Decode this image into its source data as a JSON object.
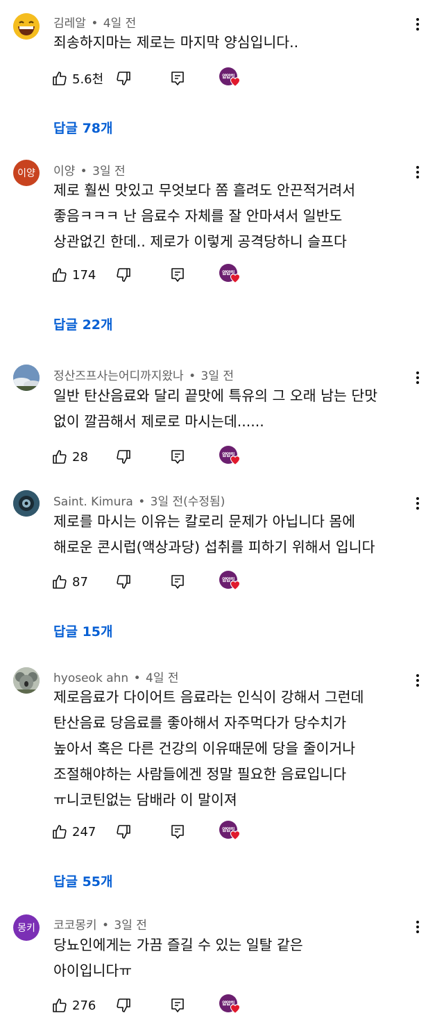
{
  "comments": [
    {
      "author": "김레알",
      "time": "4일 전",
      "edited": "",
      "lines": [
        "죄송하지마는 제로는 마지막 양심입니다.."
      ],
      "likes": "5.6천",
      "replies": "답글 78개",
      "avatar_text": "",
      "avatar_kind": "emoji-grin",
      "avatar_color": "#f2b60d"
    },
    {
      "author": "이양",
      "time": "3일 전",
      "edited": "",
      "lines": [
        "제로 훨씬 맛있고 무엇보다 쫌 흘려도 안끈적거려서",
        "좋음ㅋㅋㅋ 난 음료수 자체를 잘 안마셔서 일반도",
        "상관없긴 한데.. 제로가 이렇게 공격당하니 슬프다"
      ],
      "likes": "174",
      "replies": "답글 22개",
      "avatar_text": "이양",
      "avatar_kind": "initials",
      "avatar_color": "#c8431f"
    },
    {
      "author": "정산즈프사는어디까지왔나",
      "time": "3일 전",
      "edited": "",
      "lines": [
        "일반 탄산음료와 달리 끝맛에 특유의 그 오래 남는 단맛",
        "없이 깔끔해서 제로로 마시는데......"
      ],
      "likes": "28",
      "replies": "",
      "avatar_text": "",
      "avatar_kind": "photo-sky",
      "avatar_color": "#7a9cc0"
    },
    {
      "author": "Saint. Kimura",
      "time": "3일 전",
      "edited": "(수정됨)",
      "lines": [
        "제로를 마시는 이유는 칼로리 문제가 아닙니다 몸에",
        "해로운 콘시럽(액상과당) 섭취를 피하기 위해서 입니다"
      ],
      "likes": "87",
      "replies": "답글 15개",
      "avatar_text": "",
      "avatar_kind": "photo-dark",
      "avatar_color": "#2b4a5c"
    },
    {
      "author": "hyoseok ahn",
      "time": "4일 전",
      "edited": "",
      "lines": [
        "제로음료가 다이어트 음료라는 인식이 강해서 그런데",
        "탄산음료 당음료를 좋아해서 자주먹다가 당수치가",
        "높아서 혹은 다른 건강의 이유때문에 당을 줄이거나",
        "조절해야하는 사람들에겐 정말 필요한 음료입니다",
        "ㅠ니코틴없는 담배라 이 말이져"
      ],
      "likes": "247",
      "replies": "답글 55개",
      "avatar_text": "",
      "avatar_kind": "photo-koala",
      "avatar_color": "#9aa39a"
    },
    {
      "author": "코코몽키",
      "time": "3일 전",
      "edited": "",
      "lines": [
        "당뇨인에게는 가끔 즐길 수 있는 일탈 같은",
        "아이입니다ㅠ"
      ],
      "likes": "276",
      "replies": "",
      "avatar_text": "몽키",
      "avatar_kind": "initials",
      "avatar_color": "#7b2fb5"
    }
  ],
  "creator_badge_text": "얍얍칫",
  "colors": {
    "link": "#065fd4",
    "creator_heart": "#e0192d",
    "creator_ring": "#6b1f6f"
  }
}
